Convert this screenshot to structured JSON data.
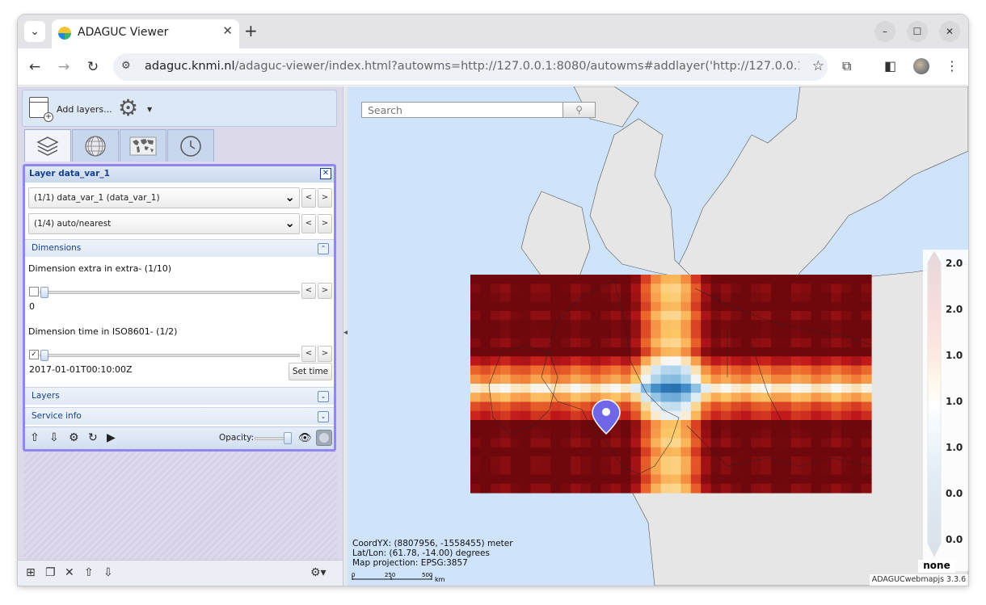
{
  "browser": {
    "tab_title": "ADAGUC Viewer",
    "url_host": "adaguc.knmi.nl",
    "url_rest": "/adaguc-viewer/index.html?autowms=http://127.0.0.1:8080/autowms#addlayer('http://127.0.0.1:8080/adagucs..."
  },
  "panel": {
    "add_layers_label": "Add layers...",
    "layer_title": "Layer data_var_1",
    "layer_select": "(1/1) data_var_1 (data_var_1)",
    "style_select": "(1/4) auto/nearest",
    "prev_label": "<",
    "next_label": ">",
    "dimensions_label": "Dimensions",
    "dim_extra_label": "Dimension extra in extra- (1/10)",
    "dim_extra_value": "0",
    "dim_extra_checked": false,
    "dim_time_label": "Dimension time in ISO8601- (1/2)",
    "dim_time_value": "2017-01-01T00:10:00Z",
    "dim_time_checked": true,
    "set_time_label": "Set time",
    "layers_label": "Layers",
    "service_info_label": "Service info",
    "opacity_label": "Opacity:",
    "opacity_level": 0.9
  },
  "map": {
    "search_placeholder": "Search",
    "coord_yx": "CoordYX: (8807956, -1558455) meter",
    "lat_lon": "Lat/Lon: (61.78, -14.00)  degrees",
    "projection": "Map projection: EPSG:3857",
    "scale_ticks": [
      "0",
      "250",
      "500"
    ],
    "scale_unit": "km",
    "legend_labels": [
      "2.0",
      "2.0",
      "1.0",
      "1.0",
      "1.0",
      "0.0",
      "0.0"
    ],
    "legend_none": "none",
    "attribution": "ADAGUCwebmapjs 3.3.6"
  },
  "colors": {
    "accent_layer_box": "#8f88f0",
    "ext_header_text": "#15428b",
    "heat_high": "#8b0f12",
    "heat_low": "#0a4f96"
  }
}
